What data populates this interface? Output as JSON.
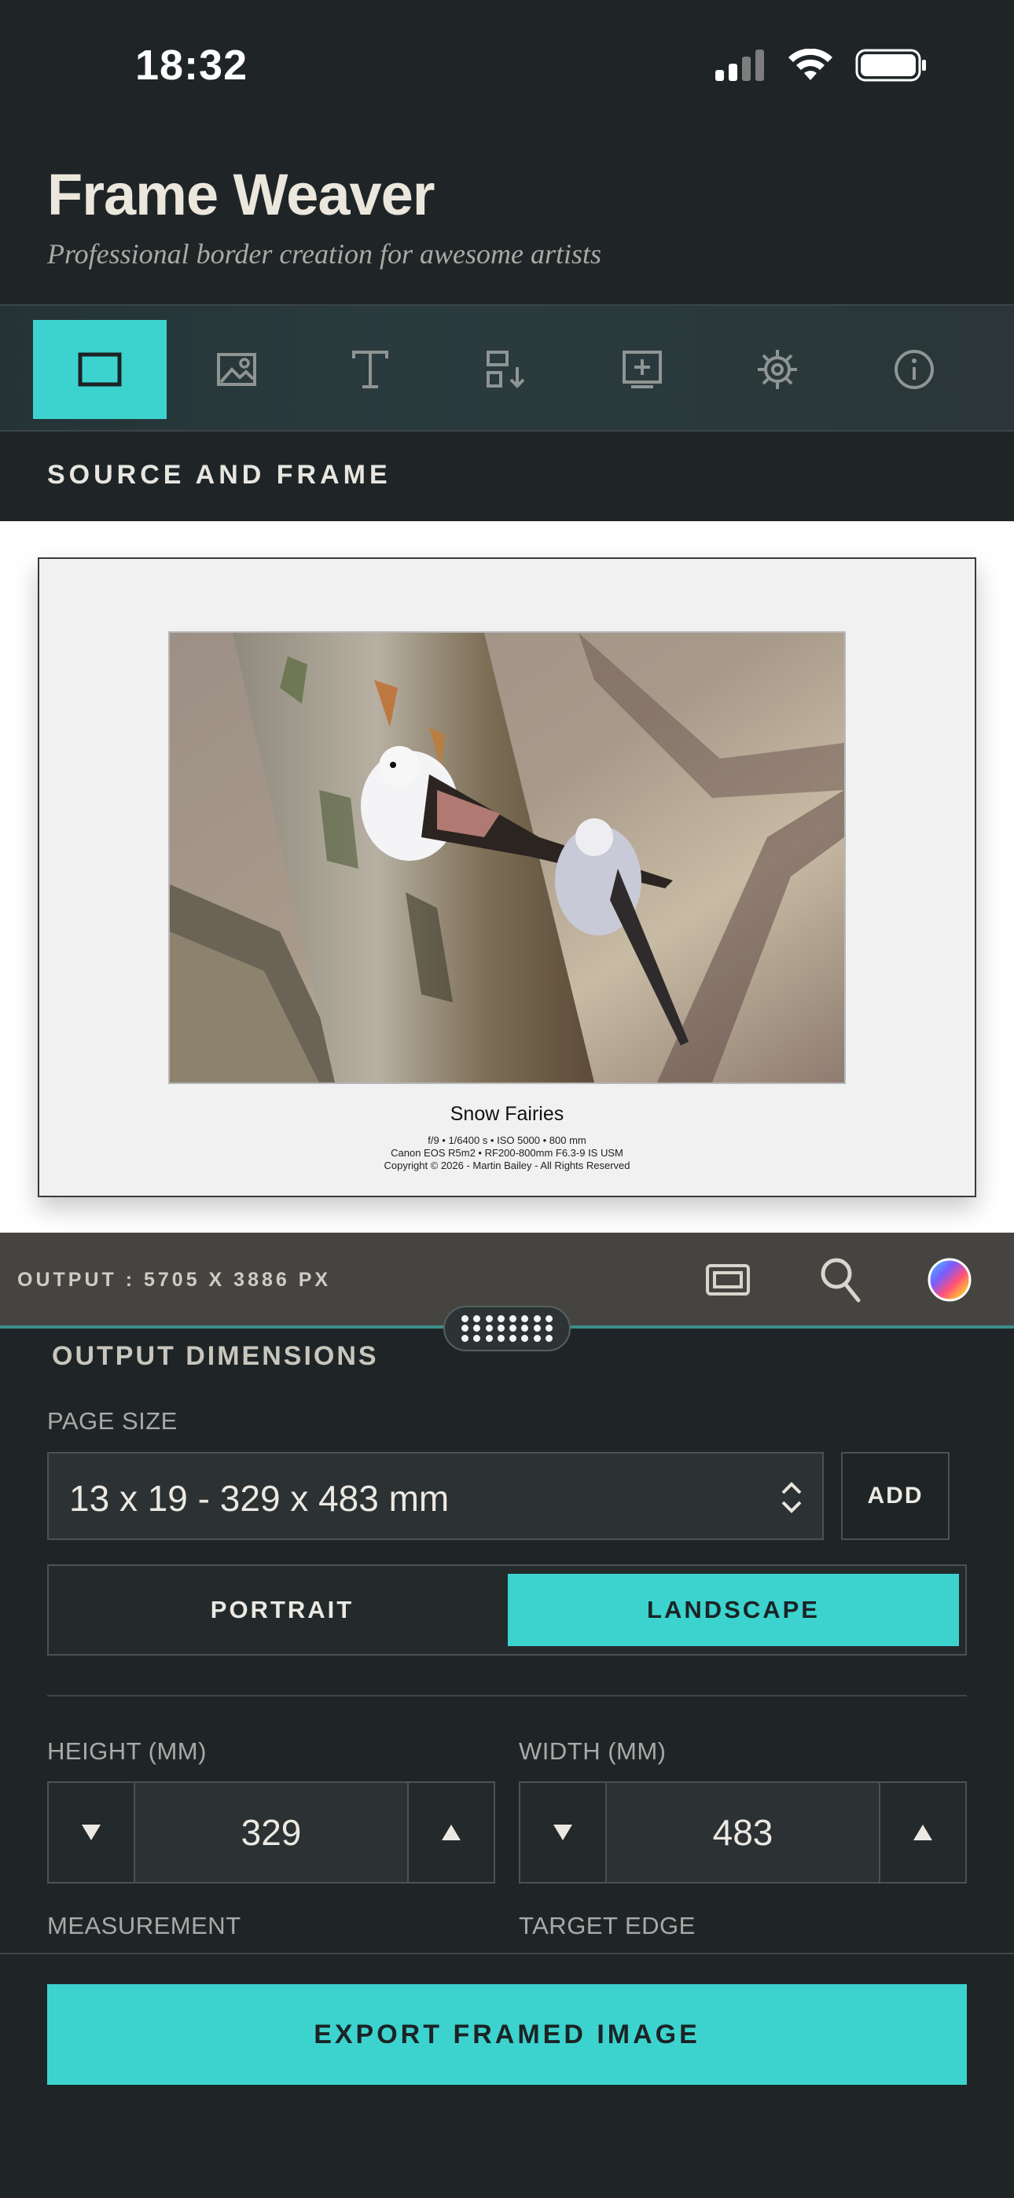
{
  "status_bar": {
    "time": "18:32"
  },
  "header": {
    "title": "Frame Weaver",
    "subtitle": "Professional border creation for awesome artists"
  },
  "toolbar": {
    "items": [
      {
        "icon": "frame-icon",
        "active": true
      },
      {
        "icon": "image-icon",
        "active": false
      },
      {
        "icon": "text-icon",
        "active": false
      },
      {
        "icon": "layout-sort-icon",
        "active": false
      },
      {
        "icon": "add-box-icon",
        "active": false
      },
      {
        "icon": "settings-icon",
        "active": false
      },
      {
        "icon": "info-icon",
        "active": false
      }
    ]
  },
  "section": {
    "title": "SOURCE AND FRAME"
  },
  "preview": {
    "caption_title": "Snow Fairies",
    "caption_lines": [
      "f/9 • 1/6400 s • ISO 5000 • 800 mm",
      "Canon EOS R5m2 • RF200-800mm F6.3-9 IS USM",
      "Copyright © 2026 - Martin Bailey - All Rights Reserved"
    ]
  },
  "output_bar": {
    "label": "OUTPUT : 5705 X 3886 PX"
  },
  "panel": {
    "title": "OUTPUT DIMENSIONS",
    "page_size_label": "PAGE SIZE",
    "page_size_value": "13 x 19 - 329 x 483 mm",
    "add_label": "ADD",
    "orientation": {
      "portrait": "PORTRAIT",
      "landscape": "LANDSCAPE",
      "selected": "LANDSCAPE"
    },
    "height_label": "HEIGHT (MM)",
    "height_value": "329",
    "width_label": "WIDTH (MM)",
    "width_value": "483",
    "measurement_label": "MEASUREMENT",
    "target_edge_label": "TARGET EDGE"
  },
  "export": {
    "label": "EXPORT FRAMED IMAGE"
  },
  "colors": {
    "accent": "#3cd3cf",
    "background": "#1f2527",
    "output_bar": "#464440"
  }
}
